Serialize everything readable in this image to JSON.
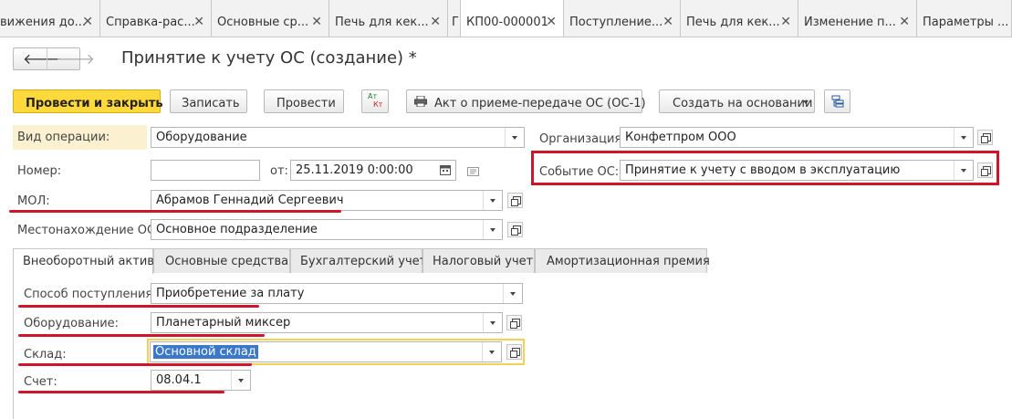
{
  "open_tabs": [
    {
      "label": "вижения до...",
      "closable": true
    },
    {
      "label": "Справка-рас...",
      "closable": true
    },
    {
      "label": "Основные ср...",
      "closable": true
    },
    {
      "label": "Печь для кек...",
      "closable": true
    },
    {
      "label": "Г",
      "closable": false
    },
    {
      "label": "КП00-000001",
      "closable": true
    },
    {
      "label": "Поступление...",
      "closable": true
    },
    {
      "label": "Печь для кек...",
      "closable": true
    },
    {
      "label": "Изменение п...",
      "closable": true
    },
    {
      "label": "Параметры ...",
      "closable": false
    }
  ],
  "window": {
    "title": "Принятие к учету ОС (создание) *"
  },
  "toolbar": {
    "post_close": "Провести и закрыть",
    "save": "Записать",
    "post": "Провести",
    "dtkt_top": "Ат",
    "dtkt_bottom": "Кт",
    "print_act": "Акт о приеме-передаче ОС (ОС-1)",
    "create_based": "Создать на основании"
  },
  "header": {
    "operation_label": "Вид операции:",
    "operation_value": "Оборудование",
    "number_label": "Номер:",
    "number_value": "",
    "date_label": "от:",
    "date_value": "25.11.2019  0:00:00",
    "mol_label": "МОЛ:",
    "mol_value": "Абрамов Геннадий Сергеевич",
    "location_label": "Местонахождение ОС:",
    "location_value": "Основное подразделение",
    "org_label": "Организация:",
    "org_value": "Конфетпром ООО",
    "event_label": "Событие ОС:",
    "event_value": "Принятие к учету с вводом в эксплуатацию"
  },
  "form_tabs": [
    {
      "label": "Внеоборотный актив",
      "active": true
    },
    {
      "label": "Основные средства",
      "active": false
    },
    {
      "label": "Бухгалтерский учет",
      "active": false
    },
    {
      "label": "Налоговый учет",
      "active": false
    },
    {
      "label": "Амортизационная премия",
      "active": false
    }
  ],
  "asset": {
    "receipt_label": "Способ поступления:",
    "receipt_value": "Приобретение за плату",
    "equipment_label": "Оборудование:",
    "equipment_value": "Планетарный миксер",
    "warehouse_label": "Склад:",
    "warehouse_value": "Основной склад",
    "account_label": "Счет:",
    "account_value": "08.04.1"
  },
  "colors": {
    "accent_yellow": "#ffd83b",
    "highlight_red": "#d0152b",
    "selection_blue": "#3a78c9",
    "label_bg": "#fbf1d0"
  },
  "icons": [
    "back-arrow-icon",
    "forward-arrow-icon",
    "printer-icon",
    "structure-icon",
    "calendar-icon",
    "open-in-window-icon",
    "dropdown-arrow-icon"
  ]
}
